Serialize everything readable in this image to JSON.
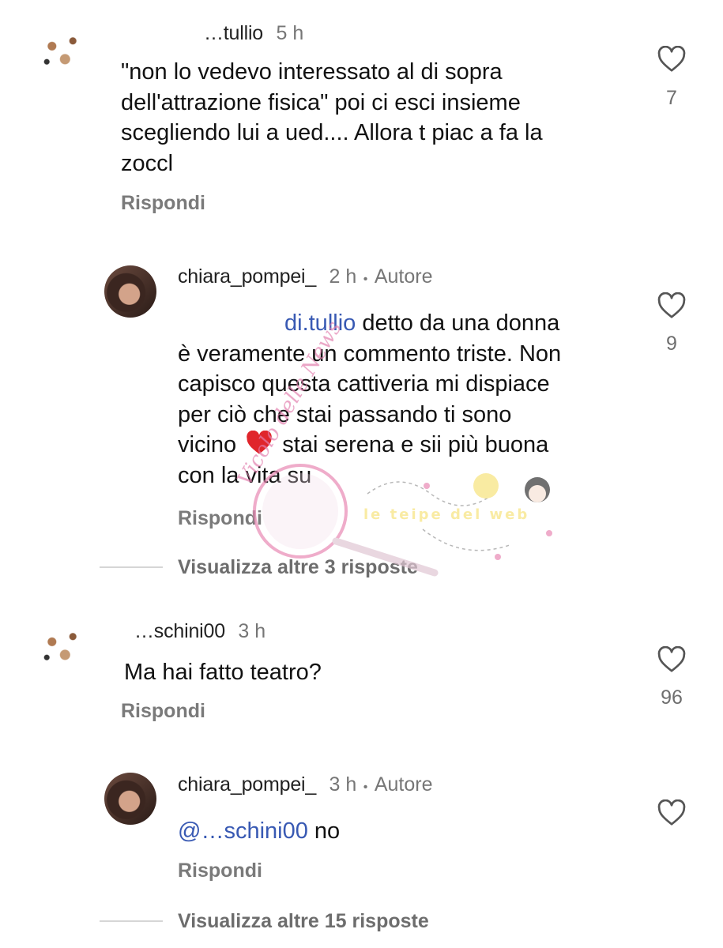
{
  "comments": [
    {
      "username": "…tullio",
      "time": "5 h",
      "text": "\"non lo vedevo interessato al di sopra dell'attrazione fisica\" poi ci esci insieme scegliendo lui a ued.... Allora t piac a fa la zoccl",
      "lines": [
        "\"non lo vedevo interessato al di sopra",
        "dell'attrazione fisica\" poi ci esci insieme",
        "scegliendo lui a ued.... Allora t piac a fa la",
        "zoccl"
      ],
      "reply_label": "Rispondi",
      "likes": "7",
      "replies": [
        {
          "username": "chiara_pompei_",
          "time": "2 h",
          "author_badge": "Autore",
          "mention": "di.tullio",
          "lines": [
            "detto da una donna",
            "è veramente un commento triste. Non",
            "capisco questa cattiveria mi dispiace",
            "per ciò che stai passando ti sono",
            "vicino",
            "stai serena e sii più buona",
            "con la vita su"
          ],
          "reply_label": "Rispondi",
          "likes": "9"
        }
      ],
      "view_more": "Visualizza altre 3 risposte"
    },
    {
      "username": "…schini00",
      "time": "3 h",
      "text": "Ma hai fatto teatro?",
      "reply_label": "Rispondi",
      "likes": "96",
      "replies": [
        {
          "username": "chiara_pompei_",
          "time": "3 h",
          "author_badge": "Autore",
          "mention": "@…schini00",
          "text": "no",
          "reply_label": "Rispondi"
        }
      ],
      "view_more": "Visualizza altre 15 risposte"
    }
  ],
  "separator": "•",
  "icons": {
    "like": "heart-outline-icon",
    "emoji": "red-heart-emoji"
  },
  "watermark": {
    "brand": "Vicolo delle News",
    "tagline": "le teipe del web"
  },
  "colors": {
    "mention": "#3859b3",
    "muted": "#767676",
    "heart_emoji": "#e0252b"
  }
}
